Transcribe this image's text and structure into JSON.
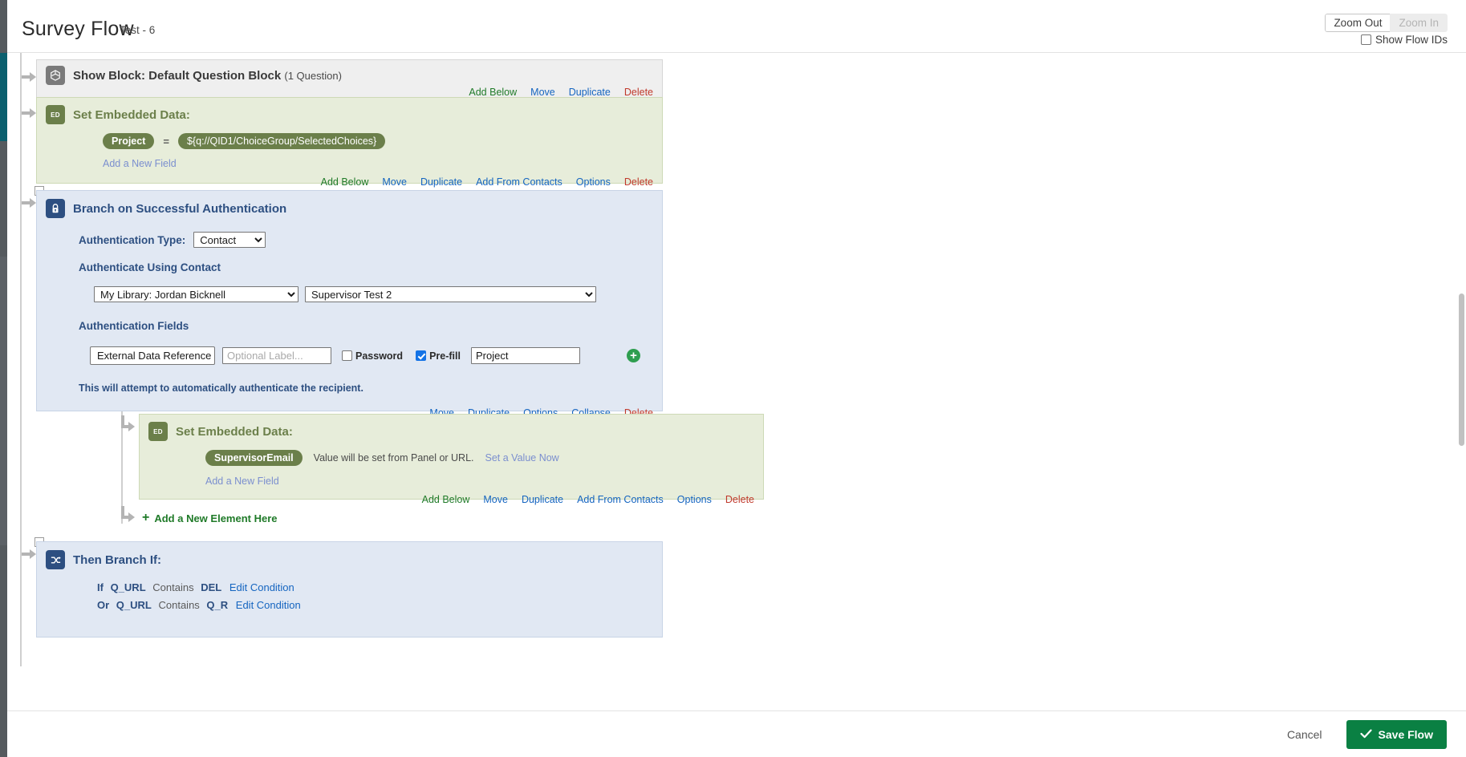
{
  "header": {
    "title": "Survey Flow",
    "subtitle": "Test - 6",
    "zoom_out": "Zoom Out",
    "zoom_in": "Zoom In",
    "show_flow_ids": "Show Flow IDs",
    "show_flow_ids_checked": false
  },
  "colors": {
    "link_add": "#1f7a28",
    "link_blue": "#1565c0",
    "link_delete": "#c0392b",
    "block_bg": "#efefef",
    "embedded_bg": "#e7edda",
    "branch_bg": "#e1e8f3",
    "embedded_accent": "#6b7f4a",
    "branch_accent": "#2d4f81",
    "save_green": "#0a8043"
  },
  "flow": {
    "show_block": {
      "icon": "cube-icon",
      "title": "Show Block: Default Question Block",
      "meta": "(1 Question)",
      "links": [
        "Add Below",
        "Move",
        "Duplicate",
        "Delete"
      ]
    },
    "embedded_data_1": {
      "icon": "ed-icon",
      "badge": "ED",
      "title": "Set Embedded Data:",
      "field_name": "Project",
      "equals": "=",
      "field_value": "${q://QID1/ChoiceGroup/SelectedChoices}",
      "add_field": "Add a New Field",
      "links": [
        "Add Below",
        "Move",
        "Duplicate",
        "Add From Contacts",
        "Options",
        "Delete"
      ]
    },
    "auth_branch": {
      "icon": "lock-icon",
      "title": "Branch on Successful Authentication",
      "auth_type_label": "Authentication Type:",
      "auth_type_value": "Contact",
      "auth_type_options": [
        "Contact"
      ],
      "using_contact_label": "Authenticate Using Contact",
      "library_value": "My Library: Jordan Bicknell",
      "library_options": [
        "My Library: Jordan Bicknell"
      ],
      "contact_list_value": "Supervisor Test 2",
      "contact_list_options": [
        "Supervisor Test 2"
      ],
      "fields_label": "Authentication Fields",
      "field_type_value": "External Data Reference",
      "field_label_placeholder": "Optional Label...",
      "field_label_value": "",
      "password_label": "Password",
      "password_checked": false,
      "prefill_label": "Pre-fill",
      "prefill_checked": true,
      "prefill_value": "Project",
      "add_field_icon": "plus-circle-icon",
      "note": "This will attempt to automatically authenticate the recipient.",
      "links": [
        "Move",
        "Duplicate",
        "Options",
        "Collapse",
        "Delete"
      ]
    },
    "embedded_data_2": {
      "icon": "ed-icon",
      "badge": "ED",
      "title": "Set Embedded Data:",
      "field_name": "SupervisorEmail",
      "value_note": "Value will be set from Panel or URL.",
      "set_value_link": "Set a Value Now",
      "add_field": "Add a New Field",
      "links": [
        "Add Below",
        "Move",
        "Duplicate",
        "Add From Contacts",
        "Options",
        "Delete"
      ]
    },
    "add_element": {
      "label": "Add a New Element Here",
      "icon": "plus-icon"
    },
    "then_branch": {
      "icon": "branch-icon",
      "title": "Then Branch If:",
      "conditions": [
        {
          "conjunction": "If",
          "field": "Q_URL",
          "operator": "Contains",
          "value": "DEL",
          "edit": "Edit Condition"
        },
        {
          "conjunction": "Or",
          "field": "Q_URL",
          "operator": "Contains",
          "value": "Q_R",
          "edit": "Edit Condition"
        }
      ]
    }
  },
  "footer": {
    "cancel": "Cancel",
    "save": "Save Flow",
    "save_icon": "check-icon"
  }
}
